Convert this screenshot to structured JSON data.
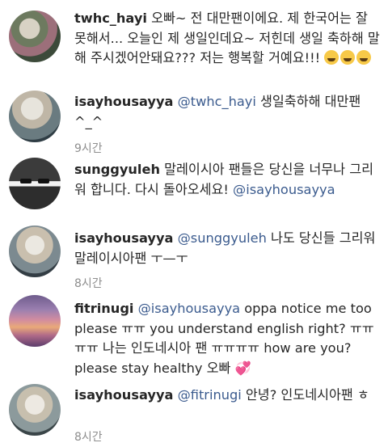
{
  "comments": [
    {
      "user": "twhc_hayi",
      "text": " 오빠~ 전 대만팬이에요. 제 한국어는 잘 못해서... 오늘인 제 생일인데요~ 저힌데 생일 축하해 말해 주시겠어안돼요??? 저는 행복할 거예요!!! ",
      "emoji": [
        "weary-laughing-face-emoji",
        "weary-laughing-face-emoji",
        "weary-laughing-face-emoji"
      ]
    },
    {
      "user": "isayhousayya",
      "mention": "@twhc_hayi",
      "text": " 생일축하해 대만팬 ^_^",
      "time": "9시간"
    },
    {
      "user": "sunggyuleh",
      "text": " 말레이시아 팬들은 당신을 너무나 그리워 합니다. 다시 돌아오세요! ",
      "mention": "@isayhousayya"
    },
    {
      "user": "isayhousayya",
      "mention": "@sunggyuleh",
      "text": " 나도 당신들 그리워 말레이시아팬 ㅜ—ㅜ",
      "time": "8시간"
    },
    {
      "user": "fitrinugi",
      "mention": "@isayhousayya",
      "text": " oppa notice me too please ㅠㅠ  you understand english right? ㅠㅠㅠㅠ 나는 인도네시아 팬 ㅠㅠㅠㅠ how are you? please stay healthy 오빠 ",
      "emoji": "💞"
    },
    {
      "user": "isayhousayya",
      "mention": "@fitrinugi",
      "text": " 안녕? 인도네시아팬 ㅎ",
      "time": "8시간"
    }
  ]
}
